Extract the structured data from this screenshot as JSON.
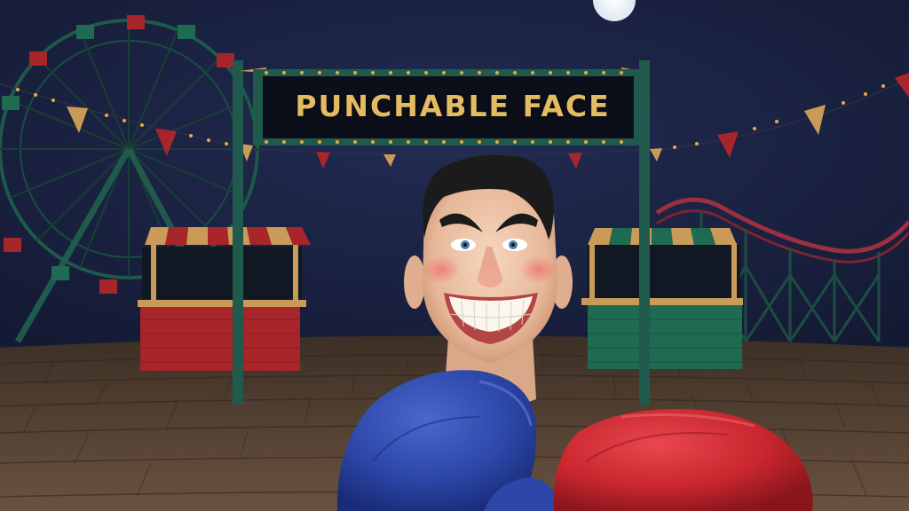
{
  "game": {
    "sign_title": "PUNCHABLE FACE"
  },
  "colors": {
    "night_sky": "#1b2243",
    "ground": "#5c4736",
    "sign_text": "#e3bb63",
    "sign_frame": "#1f5a4c",
    "left_glove": "#2c47a8",
    "right_glove": "#c9262e",
    "booth_red": "#a8252a",
    "booth_green": "#1f6b52",
    "coaster_track": "#9a3040"
  },
  "scene": {
    "left_glove_icon": "boxing-glove-blue",
    "right_glove_icon": "boxing-glove-red",
    "target": "grinning-face-head",
    "background_objects": [
      "ferris-wheel",
      "carnival-booth-red",
      "carnival-booth-green",
      "roller-coaster",
      "bunting-flags",
      "moon"
    ]
  }
}
